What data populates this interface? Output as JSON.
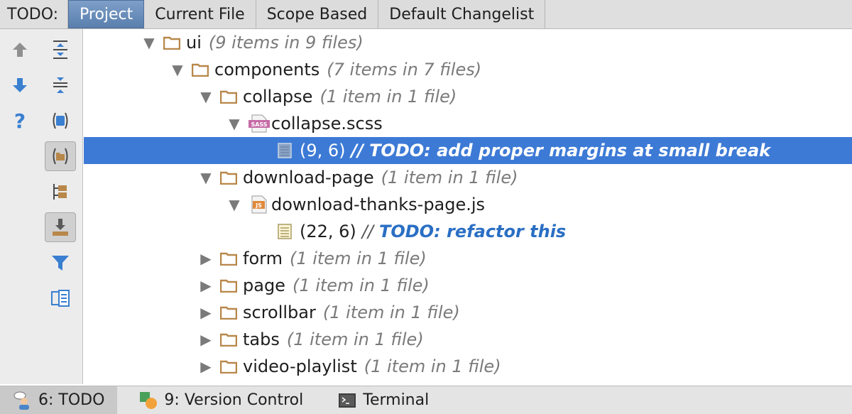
{
  "header": {
    "panel_label": "TODO:",
    "tabs": [
      {
        "label": "Project",
        "active": true
      },
      {
        "label": "Current File",
        "active": false
      },
      {
        "label": "Scope Based",
        "active": false
      },
      {
        "label": "Default Changelist",
        "active": false
      }
    ]
  },
  "toolbar": {
    "buttons": [
      {
        "name": "previous-occurrence-button",
        "icon": "arrow-up-icon"
      },
      {
        "name": "expand-all-button",
        "icon": "expand-all-icon"
      },
      {
        "name": "next-occurrence-button",
        "icon": "arrow-down-icon"
      },
      {
        "name": "collapse-all-button",
        "icon": "collapse-all-icon"
      },
      {
        "name": "help-button",
        "icon": "question-icon"
      },
      {
        "name": "filter-modules-button",
        "icon": "module-icon"
      },
      {
        "name": "group-by-packages-button",
        "icon": "package-icon",
        "pressed": true
      },
      {
        "name": "flatten-packages-button",
        "icon": "tree-structure-icon"
      },
      {
        "name": "autoscroll-to-source-button",
        "icon": "download-tray-icon",
        "pressed": true
      },
      {
        "name": "filter-todo-button",
        "icon": "funnel-icon"
      },
      {
        "name": "preview-source-button",
        "icon": "preview-panel-icon"
      }
    ],
    "accent_color": "#3a7fd0"
  },
  "tree": {
    "rows": [
      {
        "name": "ui",
        "count": "(9 items in 9 files)",
        "type": "folder",
        "expanded": true
      },
      {
        "name": "components",
        "count": "(7 items in 7 files)",
        "type": "folder",
        "expanded": true
      },
      {
        "name": "collapse",
        "count": "(1 item in 1 file)",
        "type": "folder",
        "expanded": true
      },
      {
        "name": "collapse.scss",
        "type": "sass-file",
        "file_badge": "SASS",
        "expanded": true
      },
      {
        "position": "(9, 6)",
        "prefix": "//",
        "text": "TODO: add proper margins at small break",
        "type": "todo",
        "selected": true
      },
      {
        "name": "download-page",
        "count": "(1 item in 1 file)",
        "type": "folder",
        "expanded": true
      },
      {
        "name": "download-thanks-page.js",
        "type": "js-file",
        "file_badge": "JS",
        "expanded": true
      },
      {
        "position": "(22, 6)",
        "prefix": "//",
        "text": "TODO: refactor this",
        "type": "todo",
        "selected": false
      },
      {
        "name": "form",
        "count": "(1 item in 1 file)",
        "type": "folder",
        "expanded": false
      },
      {
        "name": "page",
        "count": "(1 item in 1 file)",
        "type": "folder",
        "expanded": false
      },
      {
        "name": "scrollbar",
        "count": "(1 item in 1 file)",
        "type": "folder",
        "expanded": false
      },
      {
        "name": "tabs",
        "count": "(1 item in 1 file)",
        "type": "folder",
        "expanded": false
      },
      {
        "name": "video-playlist",
        "count": "(1 item in 1 file)",
        "type": "folder",
        "expanded": false
      }
    ],
    "selection_color": "#3d7ad6",
    "todo_color": "#2a6fc4",
    "folder_color": "#b8874a"
  },
  "statusbar": {
    "tabs": [
      {
        "label": "6: TODO",
        "icon": "todo-person-icon",
        "active": true
      },
      {
        "label": "9: Version Control",
        "icon": "version-control-icon",
        "active": false
      },
      {
        "label": "Terminal",
        "icon": "terminal-icon",
        "active": false
      }
    ]
  }
}
